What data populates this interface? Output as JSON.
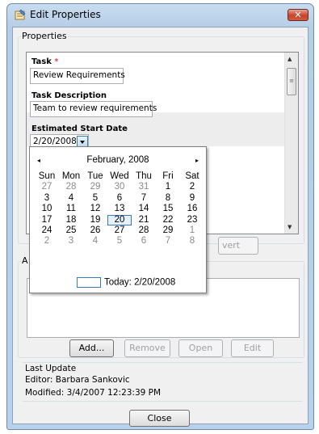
{
  "window": {
    "title": "Edit Properties",
    "close_glyph": "✕"
  },
  "properties_group": {
    "legend": "Properties",
    "task": {
      "label": "Task",
      "required_mark": "*",
      "value": "Review Requirements"
    },
    "task_description": {
      "label": "Task Description",
      "value": "Team to review requirements"
    },
    "estimated_start": {
      "label": "Estimated Start Date",
      "value": "2/20/2008"
    },
    "revert_button_partial": "vert"
  },
  "calendar": {
    "month_year": "February, 2008",
    "prev_glyph": "◂",
    "next_glyph": "▸",
    "weekdays": [
      "Sun",
      "Mon",
      "Tue",
      "Wed",
      "Thu",
      "Fri",
      "Sat"
    ],
    "weeks": [
      [
        "27",
        "28",
        "29",
        "30",
        "31",
        "1",
        "2"
      ],
      [
        "3",
        "4",
        "5",
        "6",
        "7",
        "8",
        "9"
      ],
      [
        "10",
        "11",
        "12",
        "13",
        "14",
        "15",
        "16"
      ],
      [
        "17",
        "18",
        "19",
        "20",
        "21",
        "22",
        "23"
      ],
      [
        "24",
        "25",
        "26",
        "27",
        "28",
        "29",
        "1"
      ],
      [
        "2",
        "3",
        "4",
        "5",
        "6",
        "7",
        "8"
      ]
    ],
    "other_month": [
      [
        true,
        true,
        true,
        true,
        true,
        false,
        false
      ],
      [
        false,
        false,
        false,
        false,
        false,
        false,
        false
      ],
      [
        false,
        false,
        false,
        false,
        false,
        false,
        false
      ],
      [
        false,
        false,
        false,
        false,
        false,
        false,
        false
      ],
      [
        false,
        false,
        false,
        false,
        false,
        false,
        true
      ],
      [
        true,
        true,
        true,
        true,
        true,
        true,
        true
      ]
    ],
    "selected": "20",
    "today_label": "Today: 2/20/2008"
  },
  "attachments": {
    "legend_partial": "A",
    "buttons": {
      "add": "Add...",
      "remove": "Remove",
      "open": "Open",
      "edit": "Edit"
    }
  },
  "last_update": {
    "heading": "Last Update",
    "editor": "Editor: Barbara Sankovic",
    "modified": "Modified: 3/4/2007 12:23:39 PM"
  },
  "footer": {
    "close_label": "Close"
  },
  "colors": {
    "accent": "#3b78c3",
    "required": "#e00000",
    "close_red": "#c5442c"
  }
}
